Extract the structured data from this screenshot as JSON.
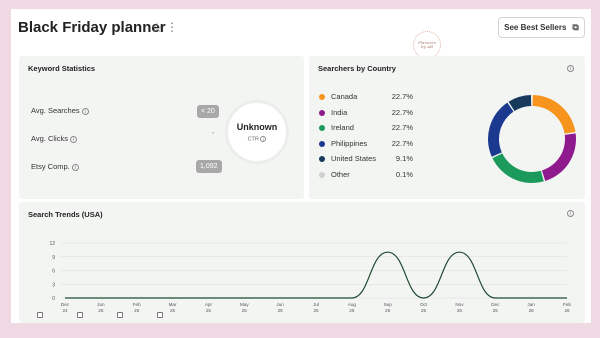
{
  "header": {
    "title": "Black Friday planner",
    "star_icon": "star-outline-icon",
    "menu_icon": "kebab-menu-icon",
    "logo_text": "Planners by AB",
    "best_sellers_label": "See Best Sellers",
    "external_icon": "external-link-icon"
  },
  "keyword_stats": {
    "title": "Keyword Statistics",
    "rows": [
      {
        "label": "Avg. Searches",
        "value": "< 20"
      },
      {
        "label": "Avg. Clicks",
        "value": "-"
      },
      {
        "label": "Etsy Comp.",
        "value": "1,092"
      }
    ],
    "ctr_value": "Unknown",
    "ctr_label": "CTR"
  },
  "searchers": {
    "title": "Searchers by Country",
    "countries": [
      {
        "name": "Canada",
        "pct": "22.7%",
        "value": 22.7,
        "color": "#f7941d"
      },
      {
        "name": "India",
        "pct": "22.7%",
        "value": 22.7,
        "color": "#8e1a8e"
      },
      {
        "name": "Ireland",
        "pct": "22.7%",
        "value": 22.7,
        "color": "#1b9a5c"
      },
      {
        "name": "Philippines",
        "pct": "22.7%",
        "value": 22.7,
        "color": "#1b3a8f"
      },
      {
        "name": "United States",
        "pct": "9.1%",
        "value": 9.1,
        "color": "#173a5c"
      },
      {
        "name": "Other",
        "pct": "0.1%",
        "value": 0.1,
        "color": "#cfcfcf"
      }
    ]
  },
  "trends": {
    "title": "Search Trends (USA)",
    "chart_data": {
      "type": "line",
      "title": "Search Trends (USA)",
      "x": [
        "Dec 24",
        "Jan 25",
        "Feb 25",
        "Mar 25",
        "Apr 25",
        "May 25",
        "Jun 25",
        "Jul 25",
        "Aug 25",
        "Sep 25",
        "Oct 25",
        "Nov 25",
        "Dec 25",
        "Jan 26",
        "Feb 26"
      ],
      "x_ticks": [
        [
          "Dec",
          "24"
        ],
        [
          "Jun",
          "25"
        ],
        [
          "Feb",
          "25"
        ],
        [
          "Mar",
          "25"
        ],
        [
          "Apr",
          "25"
        ],
        [
          "May",
          "25"
        ],
        [
          "Jun",
          "25"
        ],
        [
          "Jul",
          "25"
        ],
        [
          "Aug",
          "25"
        ],
        [
          "Sep",
          "25"
        ],
        [
          "Oct",
          "25"
        ],
        [
          "Nov",
          "25"
        ],
        [
          "Dec",
          "25"
        ],
        [
          "Jan",
          "26"
        ],
        [
          "Feb",
          "26"
        ]
      ],
      "series": [
        {
          "values": [
            0,
            0,
            0,
            0,
            0,
            0,
            0,
            0,
            0,
            10,
            0,
            10,
            0,
            0,
            0
          ],
          "color": "#1e4a2e"
        }
      ],
      "y_ticks": [
        0,
        3,
        6,
        9,
        12
      ],
      "ylim": [
        0,
        12
      ],
      "grid": true
    }
  }
}
